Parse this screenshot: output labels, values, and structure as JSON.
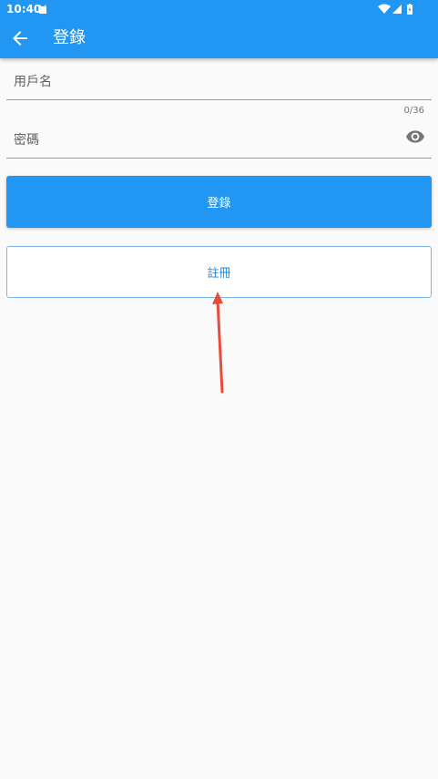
{
  "status_bar": {
    "time": "10:40"
  },
  "app_bar": {
    "title": "登錄"
  },
  "form": {
    "username_label": "用戶名",
    "counter": "0/36",
    "password_label": "密碼"
  },
  "buttons": {
    "login_label": "登錄",
    "register_label": "註冊"
  },
  "colors": {
    "primary": "#2196f3",
    "annotation_arrow": "#e74c3c"
  },
  "icons": [
    "back-arrow-icon",
    "visibility-icon",
    "wifi-icon",
    "signal-icon",
    "battery-icon",
    "notification-icon"
  ]
}
